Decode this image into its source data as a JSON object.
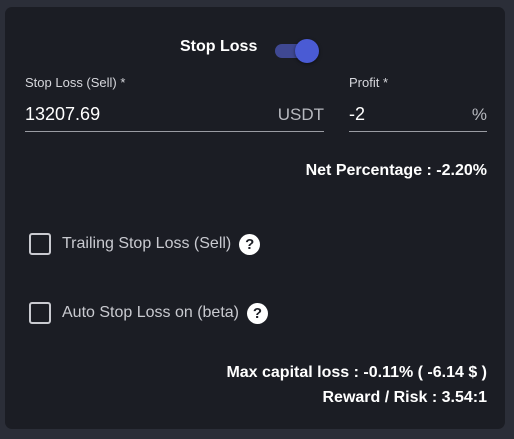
{
  "header": {
    "title": "Stop Loss",
    "toggle_on": true
  },
  "stop_loss_field": {
    "label": "Stop Loss (Sell) *",
    "value": "13207.69",
    "unit": "USDT"
  },
  "profit_field": {
    "label": "Profit *",
    "value": "-2",
    "unit": "%"
  },
  "net_percentage": "Net Percentage : -2.20%",
  "options": [
    {
      "label": "Trailing Stop Loss (Sell)",
      "checked": false,
      "help_icon": "question-circle-icon"
    },
    {
      "label": "Auto Stop Loss on (beta)",
      "checked": false,
      "help_icon": "question-circle-icon"
    }
  ],
  "help_glyph": "?",
  "summary": {
    "max_capital_loss": "Max capital loss : -0.11% ( -6.14 $ )",
    "reward_risk": "Reward / Risk : 3.54:1"
  },
  "colors": {
    "background": "#1b1d24",
    "toggle_track": "#3f4892",
    "toggle_knob": "#4a5bd4",
    "text": "#ffffff"
  }
}
